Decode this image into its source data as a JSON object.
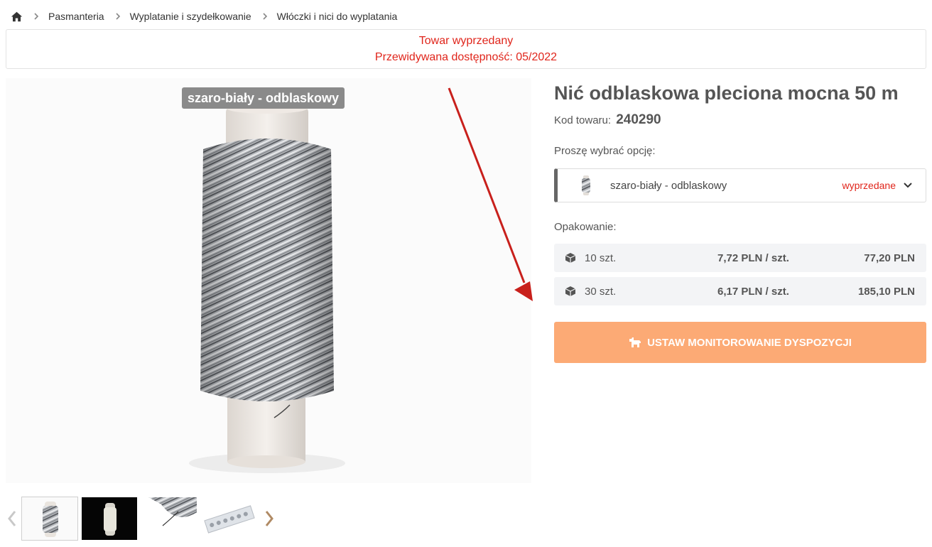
{
  "breadcrumb": {
    "items": [
      "Pasmanteria",
      "Wyplatanie i szydełkowanie",
      "Włóczki i nici do wyplatania"
    ]
  },
  "notice": {
    "line1": "Towar wyprzedany",
    "line2": "Przewidywana dostępność: 05/2022",
    "color": "#e0251b"
  },
  "gallery": {
    "variant_label": "szaro-biały - odblaskowy",
    "thumbnail_count": 4,
    "active_thumbnail": 1
  },
  "product": {
    "title": "Nić odblaskowa pleciona mocna 50 m",
    "code_label": "Kod towaru:",
    "code_value": "240290"
  },
  "options": {
    "label": "Proszę wybrać opcję:",
    "selected": "szaro-biały - odblaskowy",
    "status": "wyprzedane"
  },
  "packaging": {
    "label": "Opakowanie:",
    "rows": [
      {
        "qty": "10 szt.",
        "unit_price": "7,72 PLN / szt.",
        "total": "77,20 PLN"
      },
      {
        "qty": "30 szt.",
        "unit_price": "6,17 PLN / szt.",
        "total": "185,10 PLN"
      }
    ]
  },
  "cta": {
    "label": "USTAW MONITOROWANIE DYSPOZYCJI",
    "color": "#fcaa75"
  },
  "icons": {
    "home": "home-icon",
    "separator": "chevron-right-icon",
    "box": "package-icon",
    "dropdown": "chevron-down-icon",
    "cta": "dog-icon",
    "prev": "chevron-left-icon",
    "next": "chevron-right-icon"
  }
}
